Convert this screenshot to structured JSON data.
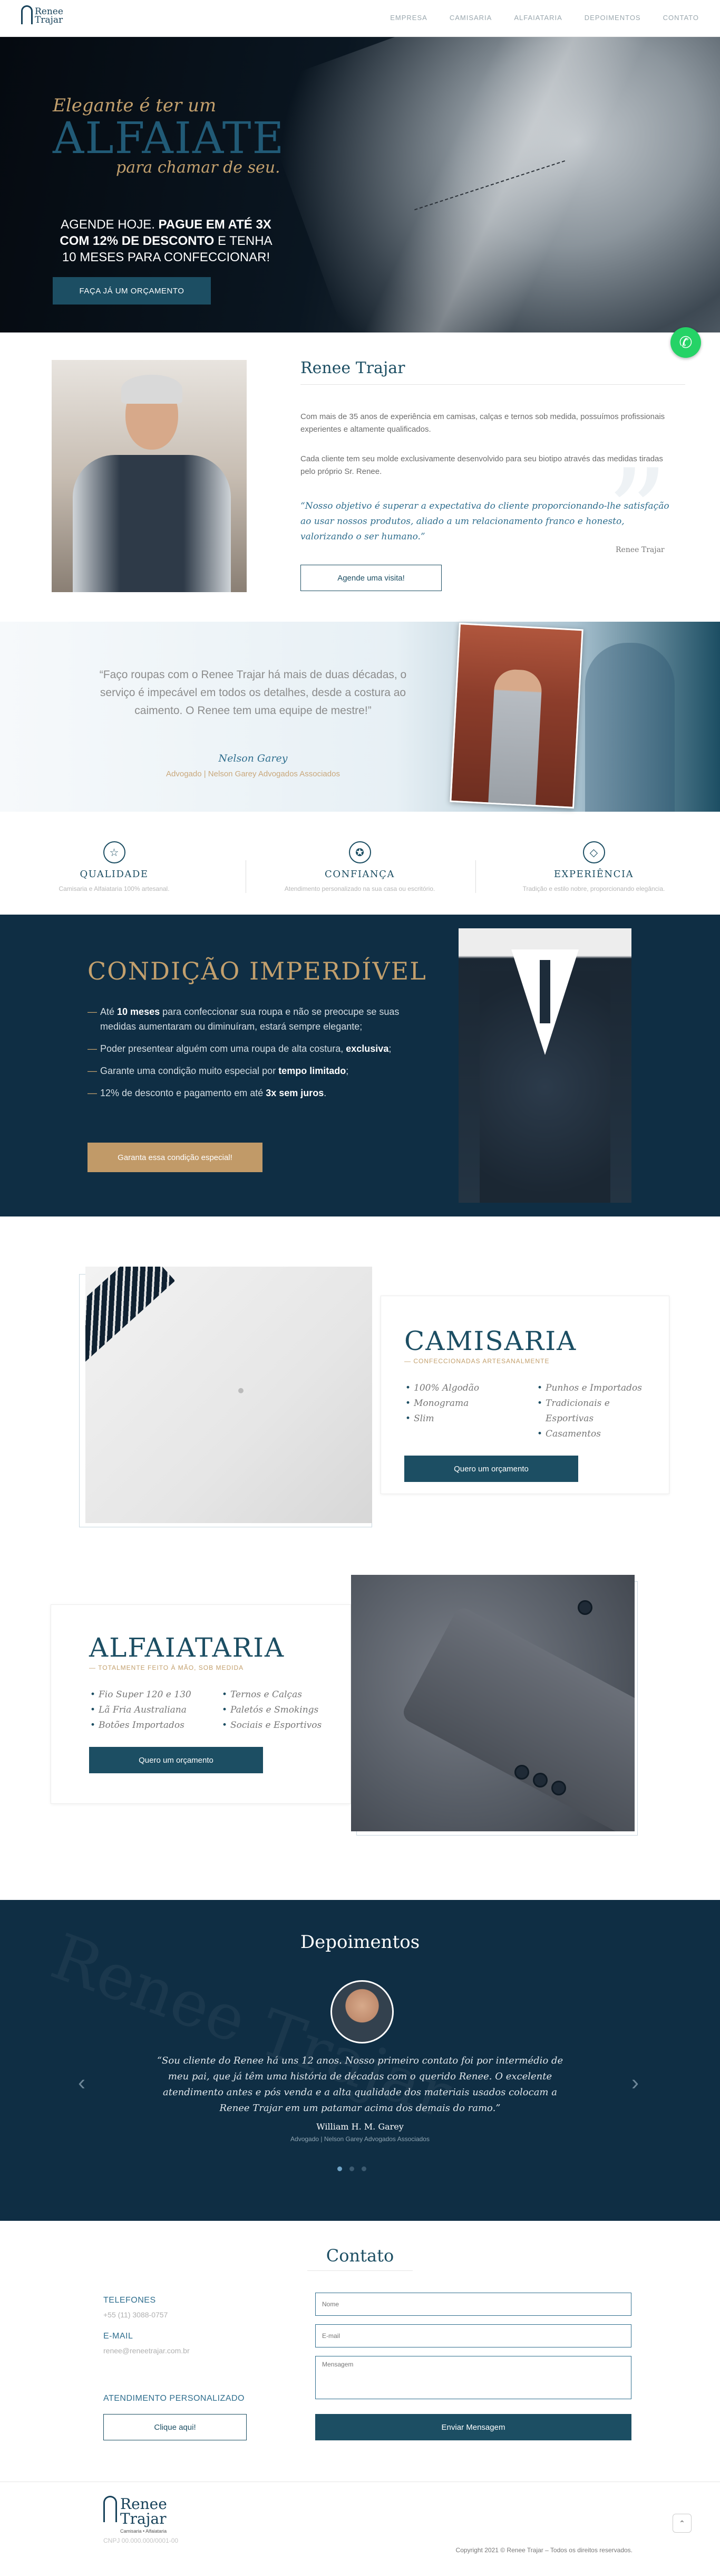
{
  "nav": {
    "logo_line1": "Renee",
    "logo_line2": "Trajar",
    "items": [
      "EMPRESA",
      "CAMISARIA",
      "ALFAIATARIA",
      "DEPOIMENTOS",
      "CONTATO"
    ]
  },
  "hero": {
    "line1": "Elegante é ter um",
    "line2": "ALFAIATE",
    "line3": "para chamar de seu.",
    "sub_a": "AGENDE HOJE. ",
    "sub_b": "PAGUE EM ATÉ 3X COM 12% DE DESCONTO",
    "sub_c": " E TENHA 10 MESES PARA CONFECCIONAR!",
    "cta": "FAÇA JÁ UM ORÇAMENTO"
  },
  "about": {
    "title": "Renee Trajar",
    "p1": "Com mais de 35 anos de experiência em camisas, calças e ternos sob medida, possuímos profissionais experientes e altamente qualificados.",
    "p2": "Cada cliente tem seu molde exclusivamente desenvolvido para seu biotipo através das medidas tiradas pelo próprio Sr. Renee.",
    "quote": "“Nosso objetivo é superar a expectativa do cliente proporcionando-lhe satisfação ao usar nossos produtos, aliado a um relacionamento franco e honesto, valorizando o ser humano.”",
    "quote_author": "Renee Trajar",
    "cta": "Agende uma visita!"
  },
  "band": {
    "quote": "“Faço roupas com o Renee Trajar há mais de duas décadas, o serviço é impecável em todos os detalhes, desde a  costura ao caimento. O Renee tem uma equipe de mestre!”",
    "name": "Nelson Garey",
    "role": "Advogado  |  Nelson Garey Advogados Associados"
  },
  "features": [
    {
      "icon": "star-icon",
      "glyph": "☆",
      "title": "QUALIDADE",
      "desc": "Camisaria e Alfaiataria 100% artesanal."
    },
    {
      "icon": "award-icon",
      "glyph": "✪",
      "title": "CONFIANÇA",
      "desc": "Atendimento personalizado na sua casa ou escritório."
    },
    {
      "icon": "diamond-icon",
      "glyph": "◇",
      "title": "EXPERIÊNCIA",
      "desc": "Tradição e estilo nobre, proporcionando elegância."
    }
  ],
  "condition": {
    "title": "CONDIÇÃO IMPERDÍVEL",
    "items": [
      {
        "a": "Até ",
        "b": "10 meses",
        "c": " para confeccionar sua roupa e não se preocupe se suas medidas aumentaram ou diminuíram, estará sempre elegante;"
      },
      {
        "a": "Poder presentear alguém com uma roupa de alta costura, ",
        "b": "exclusiva",
        "c": ";"
      },
      {
        "a": "Garante uma condição muito especial por ",
        "b": "tempo limitado",
        "c": ";"
      },
      {
        "a": "12% de desconto e pagamento em até ",
        "b": "3x sem juros",
        "c": "."
      }
    ],
    "cta": "Garanta essa condição especial!"
  },
  "camisaria": {
    "title": "CAMISARIA",
    "subtitle": "— CONFECCIONADAS ARTESANALMENTE",
    "col1": [
      "100% Algodão",
      "Monograma",
      "Slim"
    ],
    "col2": [
      "Punhos e Importados",
      "Tradicionais e Esportivas",
      "Casamentos"
    ],
    "cta": "Quero um orçamento"
  },
  "alfaiataria": {
    "title": "ALFAIATARIA",
    "subtitle": "— TOTALMENTE FEITO À MÃO, SOB MEDIDA",
    "col1": [
      "Fio Super 120 e 130",
      "Lã Fria Australiana",
      "Botões Importados"
    ],
    "col2": [
      "Ternos e Calças",
      "Paletós e Smokings",
      "Sociais e Esportivos"
    ],
    "cta": "Quero um orçamento"
  },
  "depoimentos": {
    "title": "Depoimentos",
    "bg_text": "Renee Trajar",
    "quote": "“Sou cliente do Renee há uns 12 anos. Nosso primeiro contato foi por intermédio de meu pai, que já têm uma história de décadas com o querido Renee. O excelente atendimento antes e pós venda e a alta qualidade dos materiais usados colocam a Renee Trajar em um patamar acima dos demais do ramo.”",
    "name": "William H. M. Garey",
    "role": "Advogado  |  Nelson Garey Advogados Associados",
    "prev": "‹",
    "next": "›"
  },
  "contato": {
    "title": "Contato",
    "phone_label": "TELEFONES",
    "phone": "+55 (11) 3088-0757",
    "email_label": "E-MAIL",
    "email": "renee@reneetrajar.com.br",
    "attend_label": "ATENDIMENTO PERSONALIZADO",
    "attend_cta": "Clique aqui!",
    "name_placeholder": "Nome",
    "email_placeholder": "E-mail",
    "message_placeholder": "Mensagem",
    "send": "Enviar Mensagem"
  },
  "footer": {
    "logo_line1": "Renee",
    "logo_line2": "Trajar",
    "tagline": "Camisaria • Alfaiataria",
    "small": "CNPJ 00.000.000/0001-00",
    "copyright": "Copyright  2021 © Renee Trajar – Todos os direitos reservados.",
    "top": "⌃"
  }
}
